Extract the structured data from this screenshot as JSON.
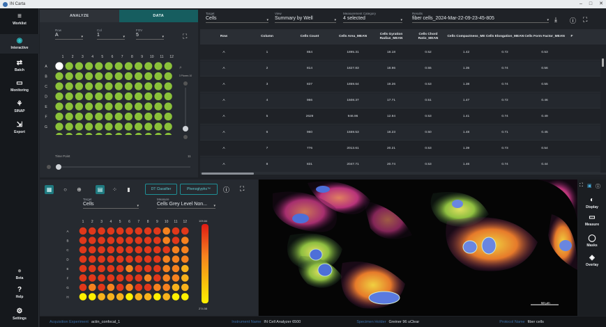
{
  "window": {
    "title": "IN Carta",
    "min": "–",
    "max": "□",
    "close": "✕"
  },
  "sidebar": {
    "items": [
      {
        "label": "Worklist",
        "icon": "≡"
      },
      {
        "label": "Interactive",
        "icon": "◉"
      },
      {
        "label": "Batch",
        "icon": "⇄"
      },
      {
        "label": "Monitoring",
        "icon": "▭"
      },
      {
        "label": "SINAP",
        "icon": "⚘"
      },
      {
        "label": "Export",
        "icon": "⇲"
      },
      {
        "label": "Beta",
        "icon": "●"
      },
      {
        "label": "Help",
        "icon": "?"
      },
      {
        "label": "Settings",
        "icon": "⚙"
      }
    ]
  },
  "tabs": {
    "analyze": "ANALYZE",
    "data": "DATA"
  },
  "well_selectors": {
    "row_label": "Row",
    "row_value": "A",
    "col_label": "Col",
    "col_value": "1",
    "fov_label": "FOV",
    "fov_value": "5"
  },
  "plate_top": {
    "cols": [
      "1",
      "2",
      "3",
      "4",
      "5",
      "6",
      "7",
      "8",
      "9",
      "10",
      "11",
      "12"
    ],
    "rows": [
      "A",
      "B",
      "C",
      "D",
      "E",
      "F",
      "G",
      "H"
    ],
    "filter_label": "3 Planes 10",
    "time_point_label": "Time Point",
    "time_point_max": "11",
    "color": "#8bc13a"
  },
  "filters": {
    "target": {
      "label": "Target",
      "value": "Cells"
    },
    "view": {
      "label": "View",
      "value": "Summary by Well"
    },
    "category": {
      "label": "Measurement Category",
      "value": "4 selected"
    },
    "results": {
      "label": "Results",
      "value": "fiber cells_2024-Mar-22-09-23-45-805"
    }
  },
  "table": {
    "columns": [
      "Row",
      "Column",
      "Cells Count",
      "Cells Area_MEAN",
      "Cells Gyration Radius_MEAN",
      "Cells Chord Ratio_MEAN",
      "Cells Compactness_ME",
      "Cells Elongation_MEAN",
      "Cells Form Factor_MEAN",
      "F"
    ],
    "rows": [
      [
        "A",
        "1",
        "854",
        "1895.31",
        "18.18",
        "0.52",
        "1.42",
        "0.72",
        "0.53"
      ],
      [
        "A",
        "2",
        "814",
        "1827.83",
        "18.96",
        "0.55",
        "1.35",
        "0.74",
        "0.56"
      ],
      [
        "A",
        "3",
        "837",
        "1859.64",
        "19.26",
        "0.53",
        "1.38",
        "0.74",
        "0.55"
      ],
      [
        "A",
        "4",
        "966",
        "1508.37",
        "17.71",
        "0.51",
        "1.47",
        "0.72",
        "0.46"
      ],
      [
        "A",
        "5",
        "2629",
        "946.96",
        "12.94",
        "0.53",
        "1.41",
        "0.74",
        "0.49"
      ],
      [
        "A",
        "6",
        "960",
        "1559.53",
        "18.23",
        "0.50",
        "1.48",
        "0.71",
        "0.45"
      ],
      [
        "A",
        "7",
        "776",
        "2013.61",
        "20.21",
        "0.53",
        "1.39",
        "0.73",
        "0.54"
      ],
      [
        "A",
        "8",
        "831",
        "2047.71",
        "20.74",
        "0.53",
        "1.46",
        "0.74",
        "0.44"
      ]
    ]
  },
  "bottom_toolbar": {
    "classifier": "DT Classifier",
    "phenoglyphs": "Phenoglyphs™"
  },
  "bottom_selectors": {
    "target_label": "Target",
    "target_value": "Cells",
    "measure_label": "Measure",
    "measure_value": "Cells Grey Level Non..."
  },
  "heatmap": {
    "max": "109.84",
    "min": "274.58",
    "cols": [
      "1",
      "2",
      "3",
      "4",
      "5",
      "6",
      "7",
      "8",
      "9",
      "10",
      "11",
      "12"
    ],
    "rows": [
      "A",
      "B",
      "C",
      "D",
      "E",
      "F",
      "G",
      "H"
    ],
    "levels": [
      [
        3,
        3,
        3,
        3,
        3,
        3,
        3,
        3,
        3,
        2,
        3,
        3
      ],
      [
        3,
        3,
        3,
        3,
        3,
        3,
        3,
        3,
        3,
        2,
        3,
        2
      ],
      [
        3,
        3,
        3,
        3,
        3,
        3,
        3,
        3,
        3,
        3,
        2,
        2
      ],
      [
        3,
        3,
        3,
        3,
        3,
        3,
        3,
        3,
        3,
        2,
        2,
        2
      ],
      [
        3,
        3,
        3,
        3,
        3,
        2,
        3,
        3,
        3,
        2,
        2,
        1
      ],
      [
        3,
        3,
        3,
        3,
        3,
        3,
        3,
        2,
        3,
        2,
        2,
        1
      ],
      [
        3,
        2,
        3,
        2,
        3,
        2,
        3,
        3,
        2,
        2,
        1,
        1
      ],
      [
        0,
        0,
        1,
        1,
        1,
        0,
        1,
        1,
        0,
        1,
        0,
        0
      ]
    ]
  },
  "viewer": {
    "scale_label": "50 µm"
  },
  "tools": [
    {
      "label": "Display",
      "icon": "◐"
    },
    {
      "label": "Measure",
      "icon": "▭"
    },
    {
      "label": "Masks",
      "icon": "◯"
    },
    {
      "label": "Overlay",
      "icon": "◈"
    }
  ],
  "status": {
    "acq_label": "Acquisition Experiment",
    "acq_value": "actin_confocal_1",
    "inst_label": "Instrument Name",
    "inst_value": "IN Cell Analyzer 6500",
    "holder_label": "Specimen Holder",
    "holder_value": "Greiner 96 uClear",
    "proto_label": "Protocol Name",
    "proto_value": "fiber cells"
  }
}
